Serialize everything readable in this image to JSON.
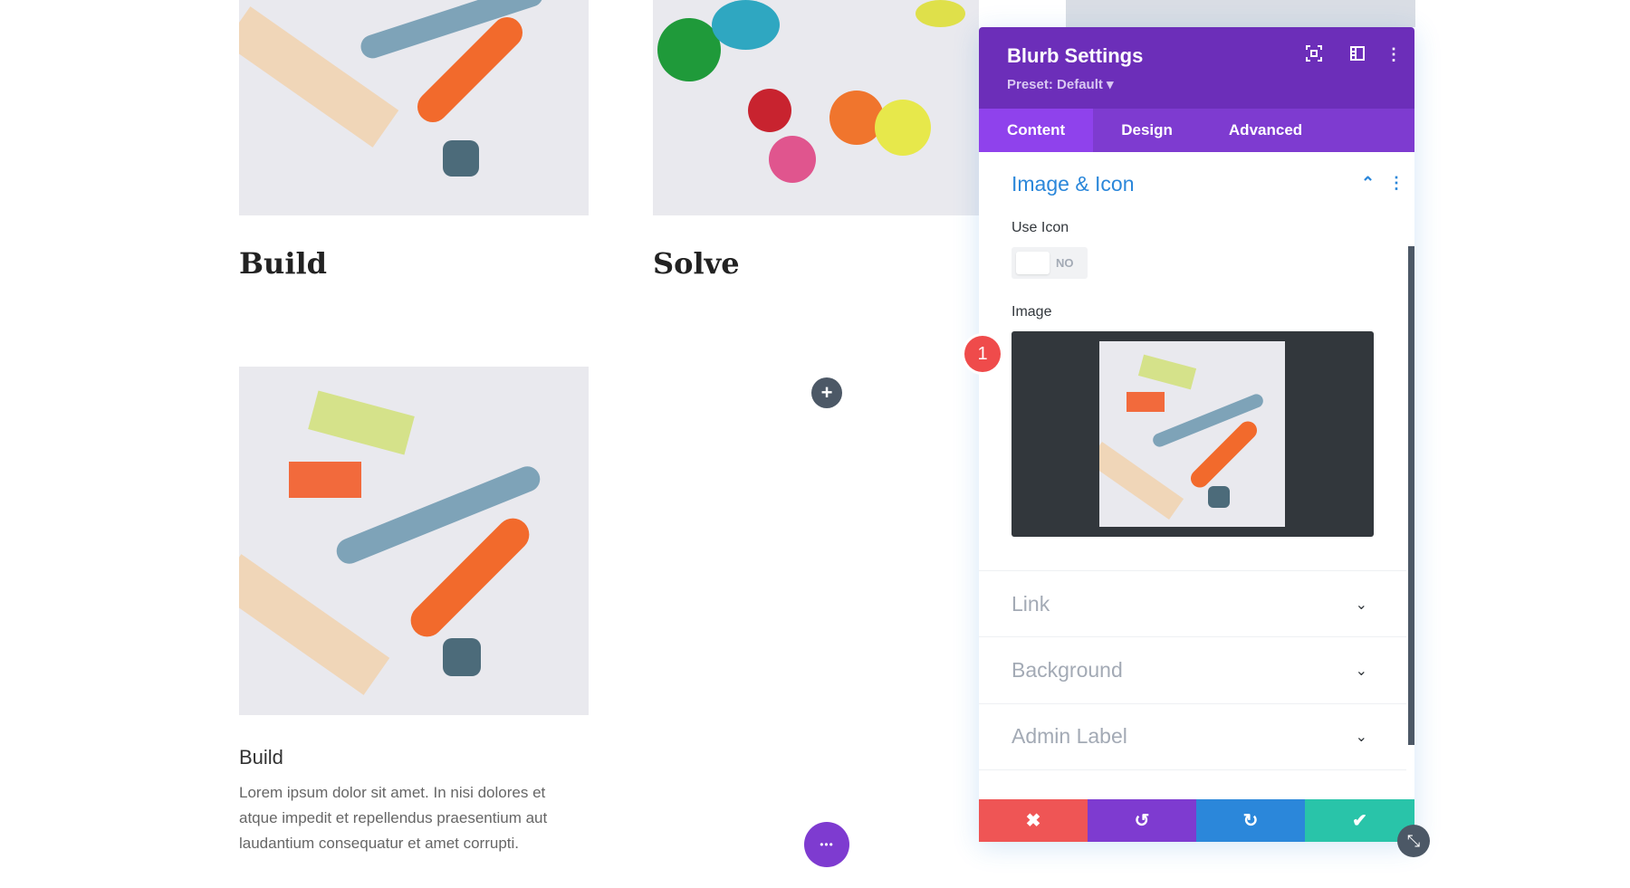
{
  "page": {
    "blurb1_title": "Build",
    "blurb2_title": "Solve",
    "blurb3_title": "Build",
    "blurb3_text_lines": [
      "Lorem ipsum dolor sit amet. In nisi dolores et",
      "atque impedit et repellendus praesentium aut",
      "laudantium consequatur et amet corrupti."
    ],
    "add_button": "+",
    "more_button": "•••"
  },
  "panel": {
    "title": "Blurb Settings",
    "preset": "Preset: Default ▾",
    "icons": [
      "focus-mode-icon",
      "split-view-icon",
      "more-options-icon"
    ],
    "tabs": [
      {
        "label": "Content",
        "active": true
      },
      {
        "label": "Design"
      },
      {
        "label": "Advanced"
      }
    ],
    "section_open": "Image & Icon",
    "use_icon_label": "Use Icon",
    "use_icon_value": "NO",
    "image_label": "Image",
    "badge": "1",
    "sections_closed": [
      "Link",
      "Background",
      "Admin Label"
    ],
    "footer_buttons": [
      {
        "name": "discard",
        "glyph": "✖",
        "color": "#ef5555"
      },
      {
        "name": "undo",
        "glyph": "↺",
        "color": "#7e3bd0"
      },
      {
        "name": "redo",
        "glyph": "↻",
        "color": "#2b87da"
      },
      {
        "name": "save",
        "glyph": "✔",
        "color": "#29c4a9"
      }
    ]
  },
  "colors": {
    "header": "#6c2eb9",
    "tabs": "#7e3bd0",
    "section_title": "#2b87da",
    "muted": "#a3aab5"
  }
}
